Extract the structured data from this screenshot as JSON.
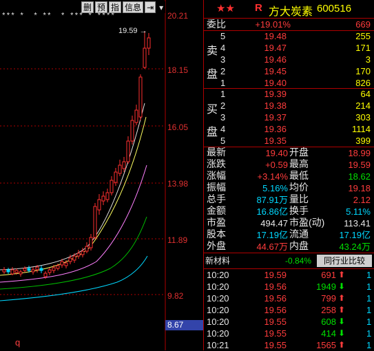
{
  "toolbar": {
    "btn1": "删",
    "btn2": "预",
    "btn3": "指",
    "btn4": "信息",
    "btn5": "⇥",
    "btn6": "▾"
  },
  "chart": {
    "price_labels": [
      "20.21",
      "18.15",
      "16.05",
      "13.98",
      "11.89",
      "9.82"
    ],
    "current_price_box": "8.67",
    "high_label": "19.59",
    "bottom_marker": "q",
    "star_marks": "*** *  * **  * *** * ****"
  },
  "stock": {
    "stars": "★★",
    "r_mark": "R",
    "name": "方大炭素",
    "code": "600516"
  },
  "weibi": {
    "label": "委比",
    "percent": "+19.01%",
    "value": "669"
  },
  "sell": {
    "label_chars": [
      "卖",
      "盘"
    ],
    "rows": [
      {
        "lv": "5",
        "price": "19.48",
        "vol": "255"
      },
      {
        "lv": "4",
        "price": "19.47",
        "vol": "171"
      },
      {
        "lv": "3",
        "price": "19.46",
        "vol": "3"
      },
      {
        "lv": "2",
        "price": "19.45",
        "vol": "170"
      },
      {
        "lv": "1",
        "price": "19.40",
        "vol": "826"
      }
    ]
  },
  "buy": {
    "label_chars": [
      "买",
      "盘"
    ],
    "rows": [
      {
        "lv": "1",
        "price": "19.39",
        "vol": "64"
      },
      {
        "lv": "2",
        "price": "19.38",
        "vol": "214"
      },
      {
        "lv": "3",
        "price": "19.37",
        "vol": "303"
      },
      {
        "lv": "4",
        "price": "19.36",
        "vol": "1114"
      },
      {
        "lv": "5",
        "price": "19.35",
        "vol": "399"
      }
    ]
  },
  "stats": [
    {
      "l1": "最新",
      "v1": "19.40",
      "l2": "开盘",
      "v2": "18.99"
    },
    {
      "l1": "涨跌",
      "v1": "+0.59",
      "l2": "最高",
      "v2": "19.59"
    },
    {
      "l1": "涨幅",
      "v1": "+3.14%",
      "l2": "最低",
      "v2": "18.62"
    },
    {
      "l1": "振幅",
      "v1": "5.16%",
      "l2": "均价",
      "v2": "19.18"
    },
    {
      "l1": "总手",
      "v1": "87.91万",
      "l2": "量比",
      "v2": "2.12"
    },
    {
      "l1": "金额",
      "v1": "16.86亿",
      "l2": "换手",
      "v2": "5.11%"
    },
    {
      "l1": "市盈",
      "v1": "494.47",
      "l2": "市盈(动)",
      "v2": "113.41"
    },
    {
      "l1": "股本",
      "v1": "17.19亿",
      "l2": "流通",
      "v2": "17.19亿"
    },
    {
      "l1": "外盘",
      "v1": "44.67万",
      "l2": "内盘",
      "v2": "43.24万"
    }
  ],
  "industry": {
    "name": "新材料",
    "change": "-0.84%",
    "button": "同行业比较"
  },
  "ticks": [
    {
      "time": "10:20",
      "price": "19.59",
      "vol": "691",
      "dir": "up",
      "n": "1"
    },
    {
      "time": "10:20",
      "price": "19.56",
      "vol": "1949",
      "dir": "down",
      "n": "1"
    },
    {
      "time": "10:20",
      "price": "19.56",
      "vol": "799",
      "dir": "up",
      "n": "1"
    },
    {
      "time": "10:20",
      "price": "19.56",
      "vol": "258",
      "dir": "up",
      "n": "1"
    },
    {
      "time": "10:20",
      "price": "19.55",
      "vol": "608",
      "dir": "down",
      "n": "1"
    },
    {
      "time": "10:20",
      "price": "19.55",
      "vol": "414",
      "dir": "down",
      "n": "1"
    },
    {
      "time": "10:21",
      "price": "19.55",
      "vol": "1565",
      "dir": "up",
      "n": "1"
    }
  ]
}
